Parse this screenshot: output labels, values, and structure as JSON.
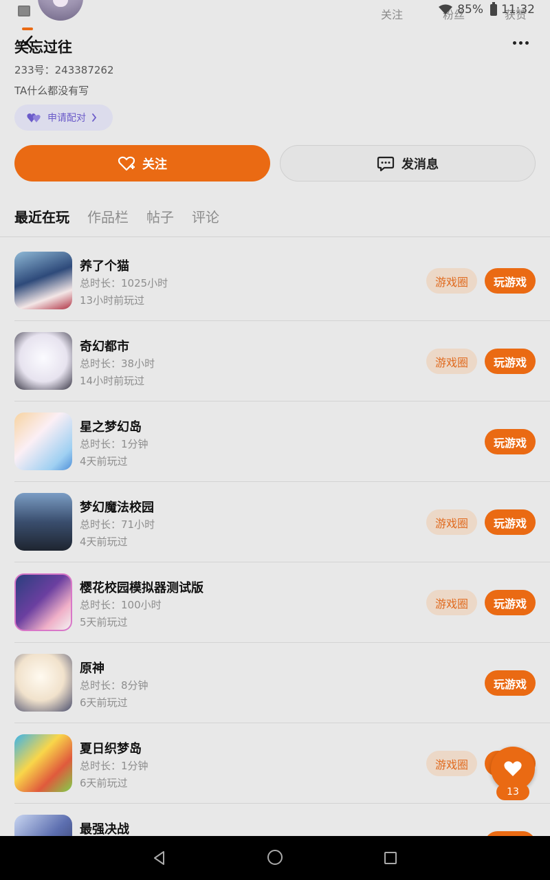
{
  "status_bar": {
    "follow_label": "关注",
    "fans_label": "粉丝",
    "money_label": "获赞",
    "battery": "85%",
    "time": "11:32"
  },
  "profile": {
    "username": "笑忘过往",
    "uid": "233号：243387262",
    "bio": "TA什么都没有写",
    "pair_label": "申请配对",
    "follow_label": "关注",
    "message_label": "发消息"
  },
  "tabs": [
    {
      "label": "最近在玩",
      "active": true
    },
    {
      "label": "作品栏",
      "active": false
    },
    {
      "label": "帖子",
      "active": false
    },
    {
      "label": "评论",
      "active": false
    }
  ],
  "games": [
    {
      "name": "养了个猫",
      "total": "总时长：1025小时",
      "last": "13小时前玩过",
      "circle": "游戏圈",
      "play": "玩游戏"
    },
    {
      "name": "奇幻都市",
      "total": "总时长：38小时",
      "last": "14小时前玩过",
      "circle": "游戏圈",
      "play": "玩游戏"
    },
    {
      "name": "星之梦幻岛",
      "total": "总时长：1分钟",
      "last": "4天前玩过",
      "circle": "",
      "play": "玩游戏"
    },
    {
      "name": "梦幻魔法校园",
      "total": "总时长：71小时",
      "last": "4天前玩过",
      "circle": "游戏圈",
      "play": "玩游戏"
    },
    {
      "name": "樱花校园模拟器测试版",
      "total": "总时长：100小时",
      "last": "5天前玩过",
      "circle": "游戏圈",
      "play": "玩游戏"
    },
    {
      "name": "原神",
      "total": "总时长：8分钟",
      "last": "6天前玩过",
      "circle": "",
      "play": "玩游戏"
    },
    {
      "name": "夏日织梦岛",
      "total": "总时长：1分钟",
      "last": "6天前玩过",
      "circle": "游戏圈",
      "play": "玩游戏"
    },
    {
      "name": "最强决战",
      "total": "",
      "last": "",
      "circle": "",
      "play": ""
    }
  ],
  "like": {
    "count": "13"
  },
  "colors": {
    "accent": "#ea6a13",
    "background": "#e8e8e8",
    "pair_text": "#6b5bc9"
  }
}
